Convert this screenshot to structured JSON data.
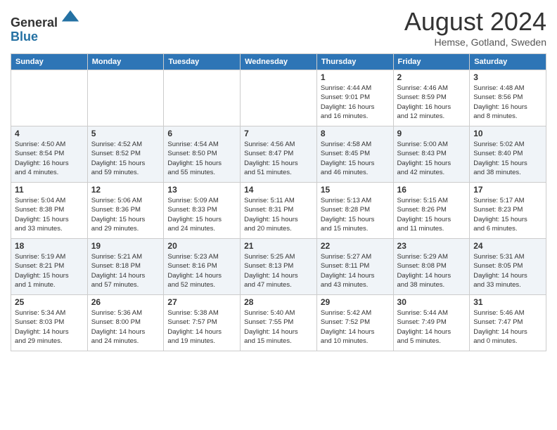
{
  "header": {
    "logo_line1": "General",
    "logo_line2": "Blue",
    "month_title": "August 2024",
    "location": "Hemse, Gotland, Sweden"
  },
  "weekdays": [
    "Sunday",
    "Monday",
    "Tuesday",
    "Wednesday",
    "Thursday",
    "Friday",
    "Saturday"
  ],
  "weeks": [
    [
      {
        "day": "",
        "info": ""
      },
      {
        "day": "",
        "info": ""
      },
      {
        "day": "",
        "info": ""
      },
      {
        "day": "",
        "info": ""
      },
      {
        "day": "1",
        "info": "Sunrise: 4:44 AM\nSunset: 9:01 PM\nDaylight: 16 hours\nand 16 minutes."
      },
      {
        "day": "2",
        "info": "Sunrise: 4:46 AM\nSunset: 8:59 PM\nDaylight: 16 hours\nand 12 minutes."
      },
      {
        "day": "3",
        "info": "Sunrise: 4:48 AM\nSunset: 8:56 PM\nDaylight: 16 hours\nand 8 minutes."
      }
    ],
    [
      {
        "day": "4",
        "info": "Sunrise: 4:50 AM\nSunset: 8:54 PM\nDaylight: 16 hours\nand 4 minutes."
      },
      {
        "day": "5",
        "info": "Sunrise: 4:52 AM\nSunset: 8:52 PM\nDaylight: 15 hours\nand 59 minutes."
      },
      {
        "day": "6",
        "info": "Sunrise: 4:54 AM\nSunset: 8:50 PM\nDaylight: 15 hours\nand 55 minutes."
      },
      {
        "day": "7",
        "info": "Sunrise: 4:56 AM\nSunset: 8:47 PM\nDaylight: 15 hours\nand 51 minutes."
      },
      {
        "day": "8",
        "info": "Sunrise: 4:58 AM\nSunset: 8:45 PM\nDaylight: 15 hours\nand 46 minutes."
      },
      {
        "day": "9",
        "info": "Sunrise: 5:00 AM\nSunset: 8:43 PM\nDaylight: 15 hours\nand 42 minutes."
      },
      {
        "day": "10",
        "info": "Sunrise: 5:02 AM\nSunset: 8:40 PM\nDaylight: 15 hours\nand 38 minutes."
      }
    ],
    [
      {
        "day": "11",
        "info": "Sunrise: 5:04 AM\nSunset: 8:38 PM\nDaylight: 15 hours\nand 33 minutes."
      },
      {
        "day": "12",
        "info": "Sunrise: 5:06 AM\nSunset: 8:36 PM\nDaylight: 15 hours\nand 29 minutes."
      },
      {
        "day": "13",
        "info": "Sunrise: 5:09 AM\nSunset: 8:33 PM\nDaylight: 15 hours\nand 24 minutes."
      },
      {
        "day": "14",
        "info": "Sunrise: 5:11 AM\nSunset: 8:31 PM\nDaylight: 15 hours\nand 20 minutes."
      },
      {
        "day": "15",
        "info": "Sunrise: 5:13 AM\nSunset: 8:28 PM\nDaylight: 15 hours\nand 15 minutes."
      },
      {
        "day": "16",
        "info": "Sunrise: 5:15 AM\nSunset: 8:26 PM\nDaylight: 15 hours\nand 11 minutes."
      },
      {
        "day": "17",
        "info": "Sunrise: 5:17 AM\nSunset: 8:23 PM\nDaylight: 15 hours\nand 6 minutes."
      }
    ],
    [
      {
        "day": "18",
        "info": "Sunrise: 5:19 AM\nSunset: 8:21 PM\nDaylight: 15 hours\nand 1 minute."
      },
      {
        "day": "19",
        "info": "Sunrise: 5:21 AM\nSunset: 8:18 PM\nDaylight: 14 hours\nand 57 minutes."
      },
      {
        "day": "20",
        "info": "Sunrise: 5:23 AM\nSunset: 8:16 PM\nDaylight: 14 hours\nand 52 minutes."
      },
      {
        "day": "21",
        "info": "Sunrise: 5:25 AM\nSunset: 8:13 PM\nDaylight: 14 hours\nand 47 minutes."
      },
      {
        "day": "22",
        "info": "Sunrise: 5:27 AM\nSunset: 8:11 PM\nDaylight: 14 hours\nand 43 minutes."
      },
      {
        "day": "23",
        "info": "Sunrise: 5:29 AM\nSunset: 8:08 PM\nDaylight: 14 hours\nand 38 minutes."
      },
      {
        "day": "24",
        "info": "Sunrise: 5:31 AM\nSunset: 8:05 PM\nDaylight: 14 hours\nand 33 minutes."
      }
    ],
    [
      {
        "day": "25",
        "info": "Sunrise: 5:34 AM\nSunset: 8:03 PM\nDaylight: 14 hours\nand 29 minutes."
      },
      {
        "day": "26",
        "info": "Sunrise: 5:36 AM\nSunset: 8:00 PM\nDaylight: 14 hours\nand 24 minutes."
      },
      {
        "day": "27",
        "info": "Sunrise: 5:38 AM\nSunset: 7:57 PM\nDaylight: 14 hours\nand 19 minutes."
      },
      {
        "day": "28",
        "info": "Sunrise: 5:40 AM\nSunset: 7:55 PM\nDaylight: 14 hours\nand 15 minutes."
      },
      {
        "day": "29",
        "info": "Sunrise: 5:42 AM\nSunset: 7:52 PM\nDaylight: 14 hours\nand 10 minutes."
      },
      {
        "day": "30",
        "info": "Sunrise: 5:44 AM\nSunset: 7:49 PM\nDaylight: 14 hours\nand 5 minutes."
      },
      {
        "day": "31",
        "info": "Sunrise: 5:46 AM\nSunset: 7:47 PM\nDaylight: 14 hours\nand 0 minutes."
      }
    ]
  ]
}
